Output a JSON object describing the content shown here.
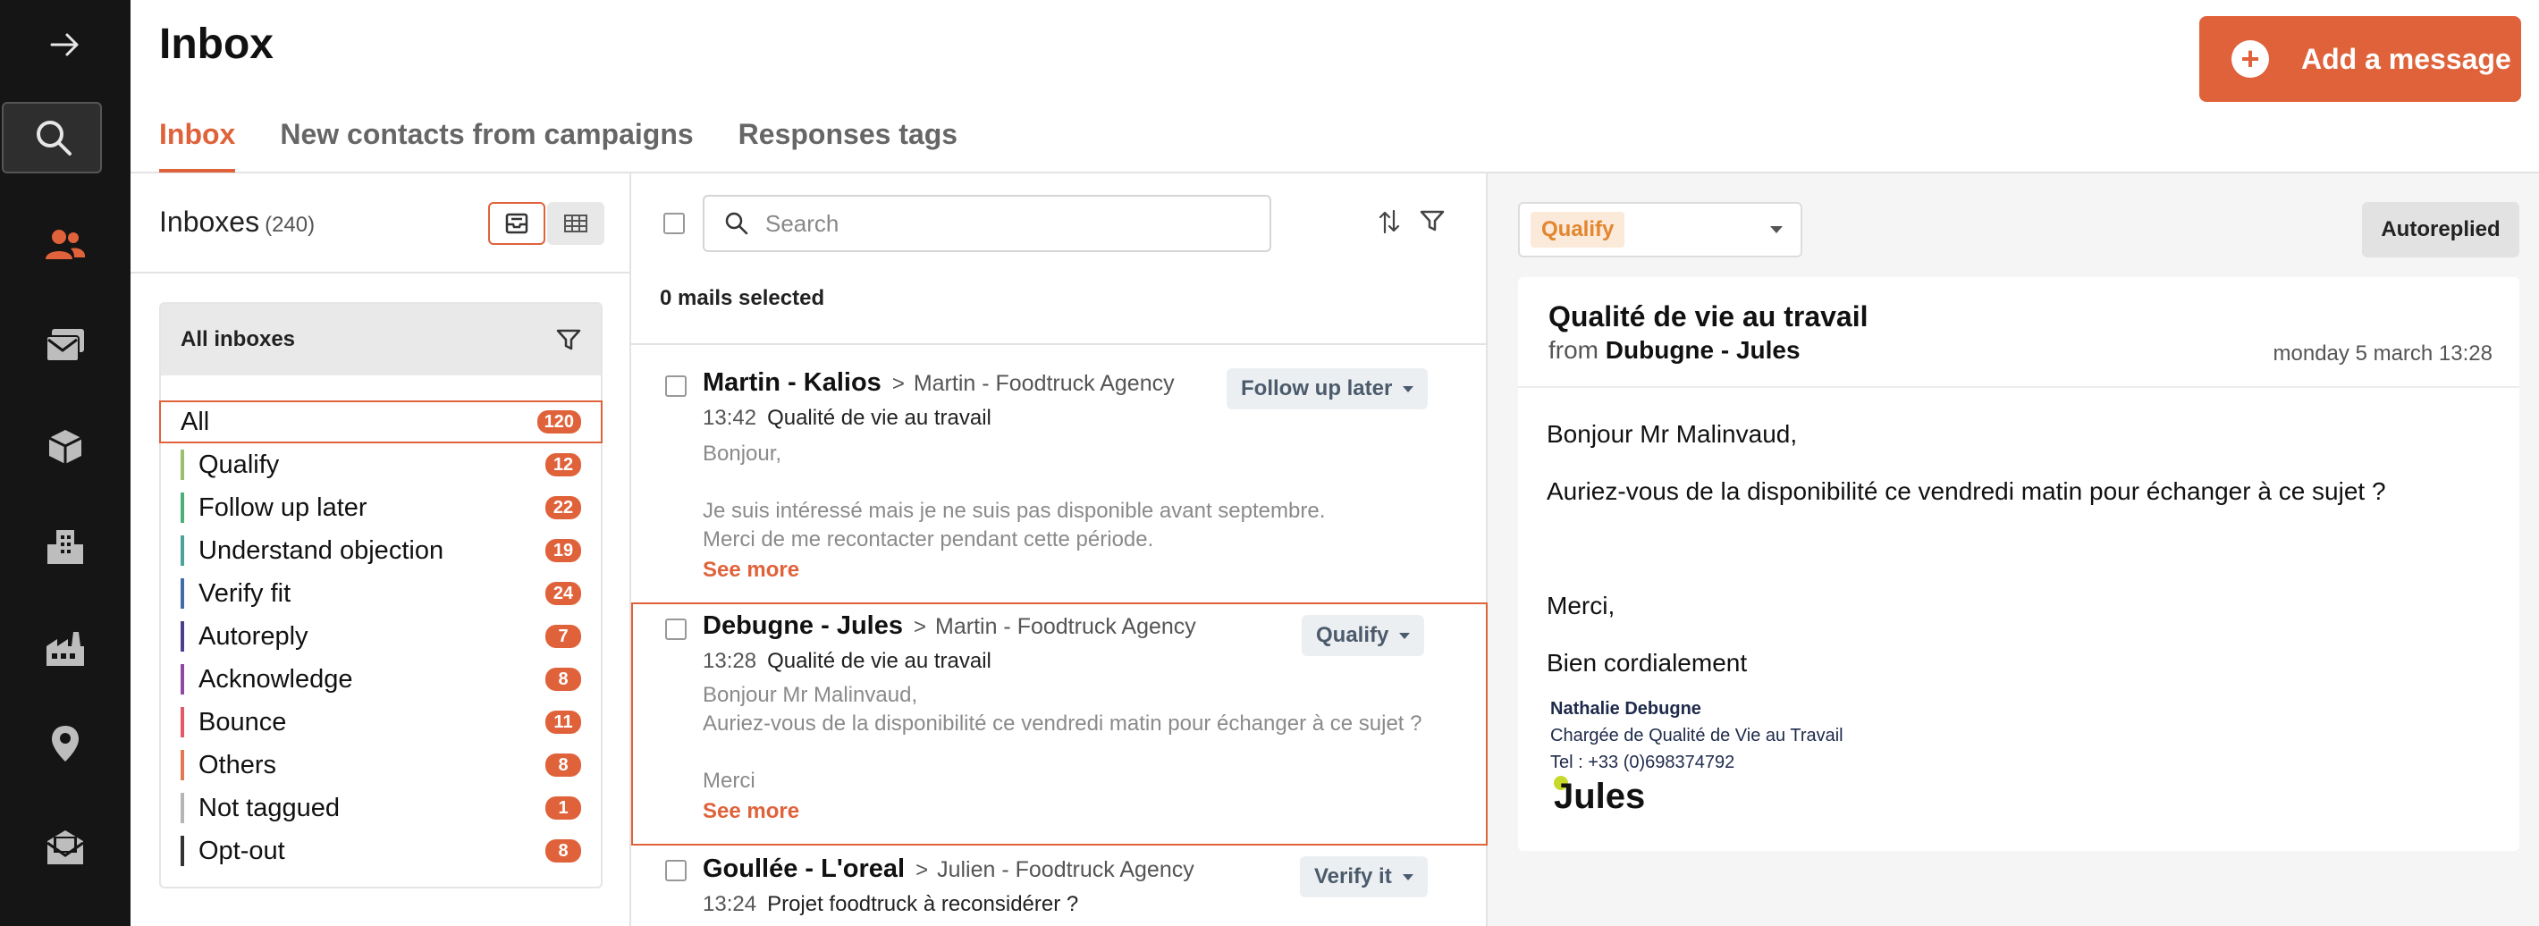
{
  "app": {
    "page_title": "Inbox",
    "add_message_label": "Add a message"
  },
  "tabs": [
    {
      "label": "Inbox",
      "active": true
    },
    {
      "label": "New contacts from campaigns",
      "active": false
    },
    {
      "label": "Responses tags",
      "active": false
    }
  ],
  "rail": {
    "icons": [
      "arrow-right-icon",
      "search-icon",
      "users-icon",
      "mail-stack-icon",
      "cube-icon",
      "buildings-icon",
      "factory-icon",
      "location-pin-icon",
      "mailbox-icon"
    ],
    "active": "users-icon",
    "accent": "#e0623b"
  },
  "inboxes": {
    "title": "Inboxes",
    "count": "(240)",
    "filter_title": "All inboxes",
    "items": [
      {
        "label": "All",
        "count": "120",
        "color": "",
        "active": true
      },
      {
        "label": "Qualify",
        "count": "12",
        "color": "#9bbf6a"
      },
      {
        "label": "Follow up later",
        "count": "22",
        "color": "#4caf7a"
      },
      {
        "label": "Understand objection",
        "count": "19",
        "color": "#4aa39a"
      },
      {
        "label": "Verify fit",
        "count": "24",
        "color": "#3d6ea8"
      },
      {
        "label": "Autoreply",
        "count": "7",
        "color": "#4b3f8f"
      },
      {
        "label": "Acknowledge",
        "count": "8",
        "color": "#8e4aa3"
      },
      {
        "label": "Bounce",
        "count": "11",
        "color": "#e05a6a"
      },
      {
        "label": "Others",
        "count": "8",
        "color": "#e07a55"
      },
      {
        "label": "Not taggued",
        "count": "1",
        "color": "#b5b5b5"
      },
      {
        "label": "Opt-out",
        "count": "8",
        "color": "#333333"
      }
    ]
  },
  "list": {
    "search_placeholder": "Search",
    "selected_label": "0 mails selected",
    "messages": [
      {
        "from": "Martin - Kalios",
        "agency": "Martin - Foodtruck Agency",
        "time": "13:42",
        "subject": "Qualité de vie au travail",
        "body": [
          "Bonjour,",
          "",
          "Je suis intéressé mais je ne suis pas disponible avant septembre.",
          "Merci de me recontacter pendant cette période."
        ],
        "see_more": "See more",
        "tag": "Follow up later"
      },
      {
        "from": "Debugne - Jules",
        "agency": "Martin - Foodtruck Agency",
        "time": "13:28",
        "subject": "Qualité de vie au travail",
        "body": [
          "Bonjour Mr Malinvaud,",
          "Auriez-vous de la disponibilité ce vendredi matin pour échanger à ce sujet ?",
          "",
          "Merci"
        ],
        "see_more": "See more",
        "tag": "Qualify"
      },
      {
        "from": "Goullée - L'oreal",
        "agency": "Julien - Foodtruck Agency",
        "time": "13:24",
        "subject": "Projet foodtruck à reconsidérer ?",
        "tag": "Verify it"
      }
    ]
  },
  "detail": {
    "qualification": "Qualify",
    "status_label": "Autoreplied",
    "subject": "Qualité de vie au travail",
    "from_prefix": "from",
    "from_name": "Dubugne - Jules",
    "date": "monday 5 march 13:28",
    "greeting": "Bonjour Mr Malinvaud,",
    "paragraph": "Auriez-vous de la disponibilité ce vendredi matin pour échanger à ce sujet ?",
    "thanks": "Merci,",
    "closing": "Bien cordialement",
    "signature": {
      "name": "Nathalie Debugne",
      "role": "Chargée de Qualité de Vie au Travail",
      "phone": "Tel : +33 (0)698374792",
      "logo_text": "Jules"
    }
  }
}
